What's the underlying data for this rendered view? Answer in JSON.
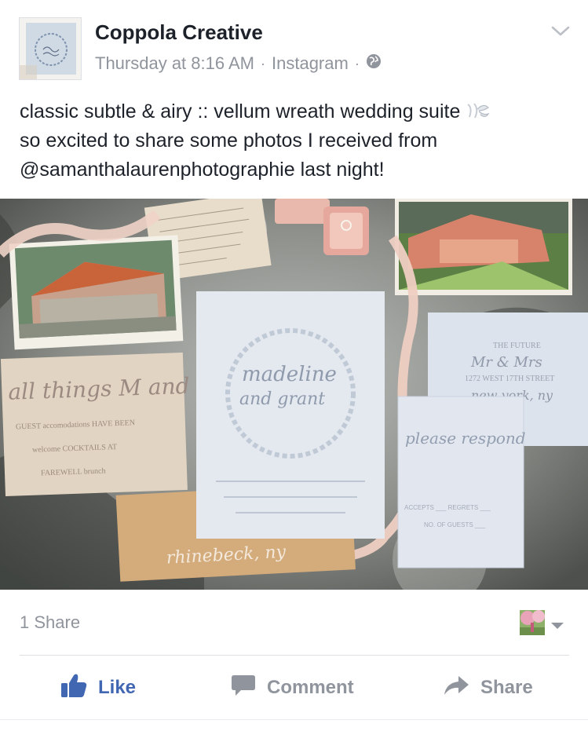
{
  "post": {
    "page_name": "Coppola Creative",
    "timestamp": "Thursday at 8:16 AM",
    "separator": "·",
    "source": "Instagram",
    "audience_icon": "globe-icon",
    "text_lines": [
      "classic subtle & airy :: vellum wreath wedding suite",
      "so excited to share some photos I received from",
      "@samanthalaurenphotographie last night!"
    ]
  },
  "photo": {
    "invitation": {
      "line1": "madeline",
      "line2": "and grant"
    },
    "envelope": {
      "line1": "THE FUTURE",
      "line2": "Mr & Mrs",
      "line3": "1272 WEST 17TH STREET",
      "line4": "new york, ny"
    },
    "rsvp": {
      "title": "please respond",
      "accepts": "ACCEPTS ___ REGRETS ___",
      "guests": "NO. OF GUESTS ___"
    },
    "details": {
      "title": "all things M and G",
      "line1": "GUEST accomodations HAVE BEEN",
      "line2": "welcome COCKTAILS AT",
      "line3": "FAREWELL brunch"
    },
    "kraft": {
      "text": "rhinebeck, ny"
    }
  },
  "engagement": {
    "share_count": "1 Share"
  },
  "actions": {
    "like": "Like",
    "comment": "Comment",
    "share": "Share"
  },
  "colors": {
    "name": "#1d2129",
    "meta": "#90949c",
    "like_blue": "#4267b2",
    "divider": "#dddfe2"
  }
}
